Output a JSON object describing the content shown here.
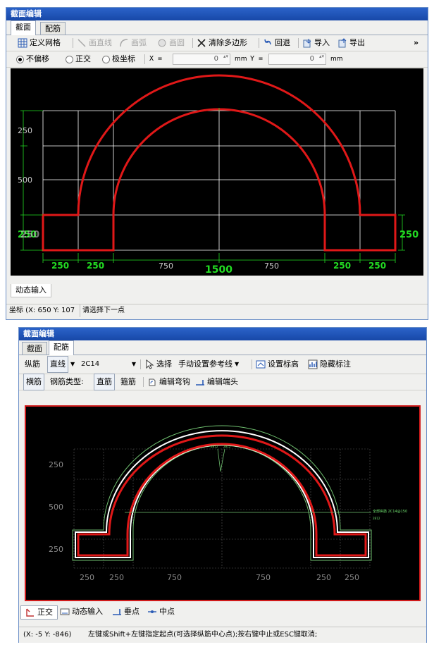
{
  "top_window": {
    "title": "截面编辑",
    "tabs": [
      {
        "label": "截面",
        "active": true
      },
      {
        "label": "配筋",
        "active": false
      }
    ],
    "toolbar": {
      "define_grid": "定义网格",
      "draw_line": "画直线",
      "draw_arc": "画弧",
      "draw_circle": "画圆",
      "clear_polygon": "清除多边形",
      "undo": "回退",
      "import": "导入",
      "export": "导出",
      "more": "»"
    },
    "offset_bar": {
      "no_offset": "不偏移",
      "orthogonal": "正交",
      "polar": "极坐标",
      "x_label": "X =",
      "x_value": "0",
      "x_unit": "mm",
      "y_label": "Y =",
      "y_value": "0",
      "y_unit": "mm",
      "selected": "不偏移"
    },
    "canvas": {
      "dim_left": [
        "250",
        "500",
        "250"
      ],
      "dim_left_overlap": "250",
      "dim_right": "250",
      "dim_bottom": [
        "250",
        "250",
        "750",
        "750",
        "250",
        "250"
      ],
      "dim_total": "1500"
    },
    "bottom_tab": "动态输入",
    "status": {
      "coords": "坐标 (X: 650 Y: 107",
      "prompt": "请选择下一点"
    }
  },
  "bottom_window": {
    "title": "截面编辑",
    "tabs": [
      {
        "label": "截面",
        "active": false
      },
      {
        "label": "配筋",
        "active": true
      }
    ],
    "toolbar1": {
      "long_bar": "纵筋",
      "line_mode": "直线",
      "bar_spec": "2C14",
      "select": "选择",
      "manual_ref": "手动设置参考线",
      "set_elevation": "设置标高",
      "hide_label": "隐藏标注"
    },
    "toolbar2": {
      "transverse": "横筋",
      "bar_type_label": "钢筋类型:",
      "straight": "直筋",
      "stirrup": "箍筋",
      "edit_hook": "编辑弯钩",
      "edit_end": "编辑端头"
    },
    "canvas": {
      "dim_left": [
        "250",
        "500",
        "250"
      ],
      "dim_bottom": [
        "250",
        "250",
        "750",
        "750",
        "250",
        "250"
      ],
      "annot_small": [
        "2B12",
        "2B12",
        "2B12"
      ],
      "annot_right": "全部纵筋 2C14@150"
    },
    "bottom_tabs": {
      "ortho": "正交",
      "dynamic_input": "动态输入",
      "perp": "垂点",
      "mid": "中点"
    },
    "status": {
      "coords": "(X: -5 Y: -846)",
      "prompt": "左键或Shift+左键指定起点(可选择纵筋中心点);按右键中止或ESC键取消;"
    }
  },
  "colors": {
    "title_bar": "#1c52b8",
    "canvas_bg": "#000000",
    "section_outline": "#e01818",
    "dimension_green": "#22dd22",
    "grid_white": "#ffffff",
    "dim_gray": "#8a8a8a"
  }
}
